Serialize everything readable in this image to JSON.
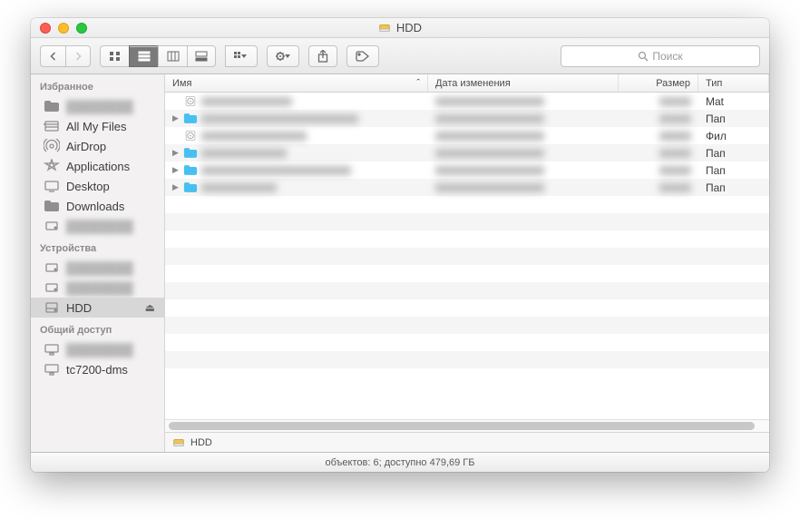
{
  "window": {
    "title": "HDD"
  },
  "search": {
    "placeholder": "Поиск"
  },
  "sidebar": {
    "sections": [
      {
        "title": "Избранное",
        "items": [
          {
            "icon": "folder",
            "label": "",
            "blurred": true
          },
          {
            "icon": "allfiles",
            "label": "All My Files"
          },
          {
            "icon": "airdrop",
            "label": "AirDrop"
          },
          {
            "icon": "apps",
            "label": "Applications"
          },
          {
            "icon": "desktop",
            "label": "Desktop"
          },
          {
            "icon": "folder",
            "label": "Downloads"
          },
          {
            "icon": "drive",
            "label": "",
            "blurred": true
          }
        ]
      },
      {
        "title": "Устройства",
        "items": [
          {
            "icon": "drive",
            "label": "",
            "blurred": true
          },
          {
            "icon": "drive",
            "label": "",
            "blurred": true
          },
          {
            "icon": "hdd",
            "label": "HDD",
            "selected": true,
            "eject": true
          }
        ]
      },
      {
        "title": "Общий доступ",
        "items": [
          {
            "icon": "screen",
            "label": "",
            "blurred": true
          },
          {
            "icon": "screen",
            "label": "tc7200-dms"
          }
        ]
      }
    ]
  },
  "columns": {
    "name": "Имя",
    "date": "Дата изменения",
    "size": "Размер",
    "type": "Тип"
  },
  "rows": [
    {
      "icon": "disk",
      "disclosure": false,
      "type": "Mat"
    },
    {
      "icon": "folder-blue",
      "disclosure": true,
      "type": "Пап"
    },
    {
      "icon": "disk",
      "disclosure": false,
      "type": "Фил"
    },
    {
      "icon": "folder-blue",
      "disclosure": true,
      "type": "Пап"
    },
    {
      "icon": "folder-blue",
      "disclosure": true,
      "type": "Пап"
    },
    {
      "icon": "folder-blue",
      "disclosure": true,
      "type": "Пап"
    }
  ],
  "empty_rows": 10,
  "pathbar": {
    "label": "HDD"
  },
  "status": "объектов: 6; доступно 479,69 ГБ"
}
